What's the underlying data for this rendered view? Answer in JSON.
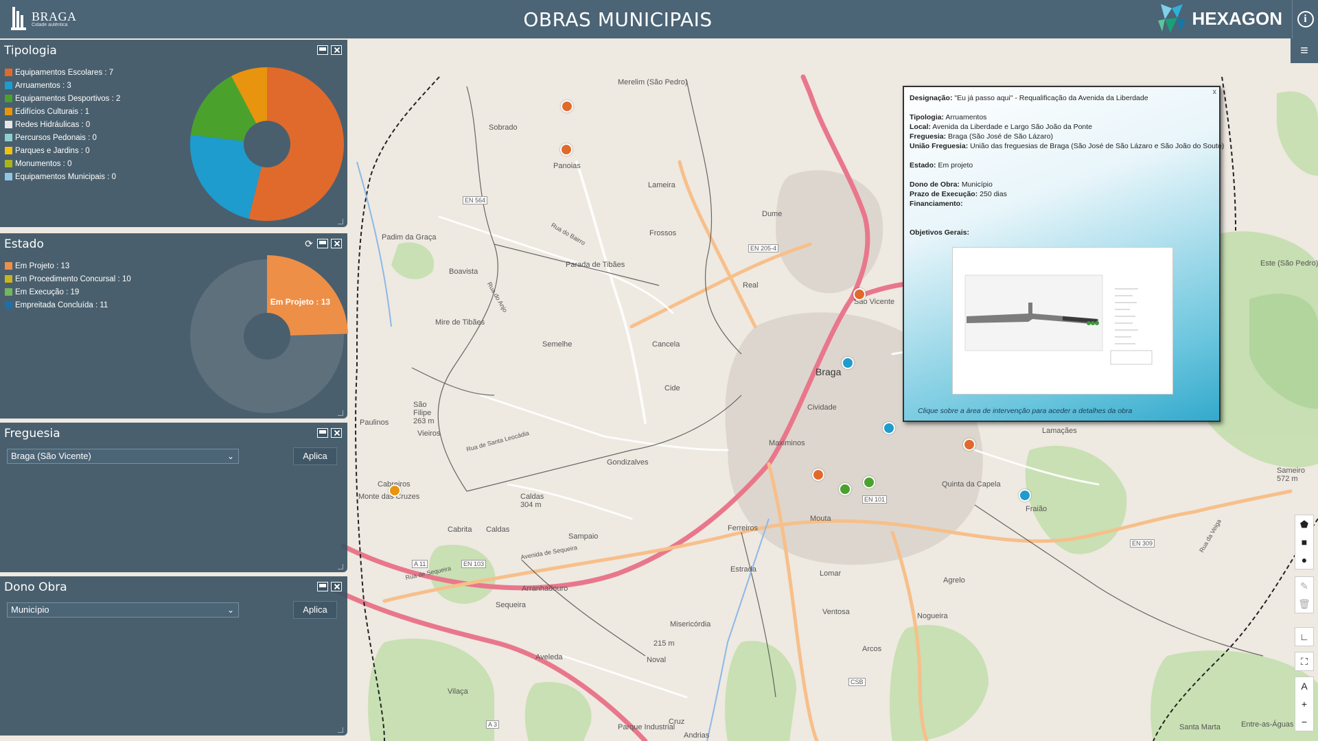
{
  "header": {
    "title": "OBRAS MUNICIPAIS",
    "logo_text": "BRAGA",
    "logo_sub": "Cidade autêntica",
    "partner_logo": "HEXAGON"
  },
  "panels": {
    "tipologia": {
      "title": "Tipologia",
      "legend": [
        {
          "label": "Equipamentos Escolares : 7",
          "color": "#e06a2c"
        },
        {
          "label": "Arruamentos : 3",
          "color": "#1e9ccd"
        },
        {
          "label": "Equipamentos Desportivos : 2",
          "color": "#4aa22d"
        },
        {
          "label": "Edifícios Culturais : 1",
          "color": "#e8940e"
        },
        {
          "label": "Redes Hidráulicas : 0",
          "color": "#e6e6e6"
        },
        {
          "label": "Percursos Pedonais : 0",
          "color": "#8ecfcf"
        },
        {
          "label": "Parques e Jardins : 0",
          "color": "#f0c20f"
        },
        {
          "label": "Monumentos : 0",
          "color": "#a8b61c"
        },
        {
          "label": "Equipamentos Municipais : 0",
          "color": "#8fc6e3"
        }
      ]
    },
    "estado": {
      "title": "Estado",
      "legend": [
        {
          "label": "Em Projeto : 13",
          "color": "#ee8f47"
        },
        {
          "label": "Em Procedimento Concursal : 10",
          "color": "#c9b51d"
        },
        {
          "label": "Em Execução : 19",
          "color": "#76b55a"
        },
        {
          "label": "Empreitada Concluída : 11",
          "color": "#1f6fa6"
        }
      ],
      "highlight_label": "Em Projeto : 13"
    },
    "freguesia": {
      "title": "Freguesia",
      "selected": "Braga (São Vicente)",
      "apply_label": "Aplica"
    },
    "dono_obra": {
      "title": "Dono Obra",
      "selected": "Município",
      "apply_label": "Aplica"
    }
  },
  "chart_data": [
    {
      "type": "pie",
      "title": "Tipologia",
      "categories": [
        "Equipamentos Escolares",
        "Arruamentos",
        "Equipamentos Desportivos",
        "Edifícios Culturais",
        "Redes Hidráulicas",
        "Percursos Pedonais",
        "Parques e Jardins",
        "Monumentos",
        "Equipamentos Municipais"
      ],
      "values": [
        7,
        3,
        2,
        1,
        0,
        0,
        0,
        0,
        0
      ],
      "colors": [
        "#e06a2c",
        "#1e9ccd",
        "#4aa22d",
        "#e8940e",
        "#e6e6e6",
        "#8ecfcf",
        "#f0c20f",
        "#a8b61c",
        "#8fc6e3"
      ]
    },
    {
      "type": "pie",
      "title": "Estado",
      "categories": [
        "Em Projeto",
        "Em Procedimento Concursal",
        "Em Execução",
        "Empreitada Concluída"
      ],
      "values": [
        13,
        10,
        19,
        11
      ],
      "colors": [
        "#ee8f47",
        "#c9b51d",
        "#76b55a",
        "#1f6fa6"
      ],
      "highlighted": "Em Projeto"
    }
  ],
  "popup": {
    "designacao_label": "Designação:",
    "designacao": "\"Eu já passo aqui\" - Requalificação da Avenida da Liberdade",
    "tipologia_label": "Tipologia:",
    "tipologia": "Arruamentos",
    "local_label": "Local:",
    "local": "Avenida da Liberdade e Largo São João da Ponte",
    "freguesia_label": "Freguesia:",
    "freguesia": "Braga (São José de São Lázaro)",
    "uniao_label": "União Freguesia:",
    "uniao": "União das freguesias de Braga (São José de São Lázaro e São João do Souto)",
    "estado_label": "Estado:",
    "estado": "Em projeto",
    "dono_label": "Dono de Obra:",
    "dono": "Município",
    "prazo_label": "Prazo de Execução:",
    "prazo": "250 dias",
    "financiamento_label": "Financiamento:",
    "objetivos_label": "Objetivos Gerais:",
    "hint": "Clique sobre a área de intervenção para aceder a detalhes da obra",
    "close": "x"
  },
  "map": {
    "labels": [
      {
        "text": "Braga",
        "big": true
      },
      {
        "text": "Merelim (São Pedro)"
      },
      {
        "text": "Sobrado"
      },
      {
        "text": "Panoias"
      },
      {
        "text": "Lameira"
      },
      {
        "text": "Dume"
      },
      {
        "text": "Frossos"
      },
      {
        "text": "Padim da Graça"
      },
      {
        "text": "Parada de Tibães"
      },
      {
        "text": "Boavista"
      },
      {
        "text": "Mire de Tibães"
      },
      {
        "text": "Semelhe"
      },
      {
        "text": "Cancela"
      },
      {
        "text": "Real"
      },
      {
        "text": "São Vicente"
      },
      {
        "text": "Cividade"
      },
      {
        "text": "Maximinos"
      },
      {
        "text": "Gondizalves"
      },
      {
        "text": "Cide"
      },
      {
        "text": "Paulinos"
      },
      {
        "text": "Vieiros"
      },
      {
        "text": "Monte das Cruzes"
      },
      {
        "text": "Cabreiros"
      },
      {
        "text": "Caldas"
      },
      {
        "text": "Cabrita"
      },
      {
        "text": "Sampaio"
      },
      {
        "text": "Ferreiros"
      },
      {
        "text": "Arranhadouro"
      },
      {
        "text": "Sequeira"
      },
      {
        "text": "Estrada"
      },
      {
        "text": "Mouta"
      },
      {
        "text": "Lomar"
      },
      {
        "text": "Ventosa"
      },
      {
        "text": "Misericórdia"
      },
      {
        "text": "Aveleda"
      },
      {
        "text": "Vilaça"
      },
      {
        "text": "Noval"
      },
      {
        "text": "Arcos"
      },
      {
        "text": "Nogueira"
      },
      {
        "text": "Agrelo"
      },
      {
        "text": "Lamaçães"
      },
      {
        "text": "Quinta da Capela"
      },
      {
        "text": "Fraião"
      },
      {
        "text": "Este (São Pedro)"
      },
      {
        "text": "Entre-as-Águas"
      },
      {
        "text": "Parque Industrial"
      },
      {
        "text": "Cruz"
      },
      {
        "text": "Santa Marta"
      },
      {
        "text": "Andrias"
      },
      {
        "text": "São Filipe 263 m"
      },
      {
        "text": "Caldas 304 m"
      },
      {
        "text": "215 m"
      },
      {
        "text": "Sameiro 572 m"
      },
      {
        "text": "EN 564"
      },
      {
        "text": "EN 205-4"
      },
      {
        "text": "EN 101"
      },
      {
        "text": "EN 103"
      },
      {
        "text": "EN 309"
      },
      {
        "text": "A 11"
      },
      {
        "text": "A 3"
      },
      {
        "text": "CSB"
      },
      {
        "text": "Rua de Sequeira"
      },
      {
        "text": "Avenida de Sequeira"
      },
      {
        "text": "Rua de Santa Leocádia"
      },
      {
        "text": "Rua do Anjo"
      },
      {
        "text": "Rua do Bairro"
      },
      {
        "text": "Rua da Veiga"
      }
    ],
    "markers": [
      {
        "category": "Equipamentos Escolares",
        "color": "#e06a2c"
      },
      {
        "category": "Equipamentos Escolares",
        "color": "#e06a2c"
      },
      {
        "category": "Equipamentos Escolares",
        "color": "#e06a2c"
      },
      {
        "category": "Arruamentos",
        "color": "#1e9ccd"
      },
      {
        "category": "Arruamentos",
        "color": "#1e9ccd"
      },
      {
        "category": "Equipamentos Escolares",
        "color": "#e06a2c"
      },
      {
        "category": "Equipamentos Escolares",
        "color": "#e06a2c"
      },
      {
        "category": "Equipamentos Desportivos",
        "color": "#4aa22d"
      },
      {
        "category": "Equipamentos Desportivos",
        "color": "#4aa22d"
      },
      {
        "category": "Arruamentos",
        "color": "#1e9ccd"
      },
      {
        "category": "Edifícios Culturais",
        "color": "#e8940e"
      }
    ]
  },
  "map_controls": {
    "draw": [
      "polygon-icon",
      "square-icon",
      "circle-icon",
      "edit-icon",
      "trash-icon"
    ],
    "measure": "ruler-icon",
    "fullscreen": "fullscreen-icon",
    "north": "A",
    "zoom_in": "+",
    "zoom_out": "−"
  }
}
